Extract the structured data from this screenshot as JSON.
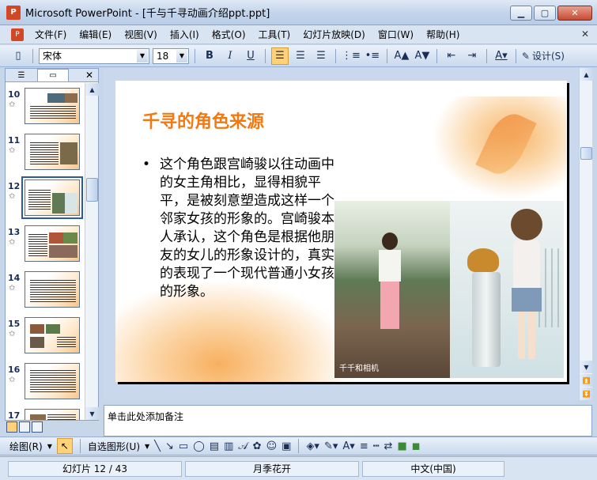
{
  "window": {
    "title": "Microsoft PowerPoint - [千与千寻动画介绍ppt.ppt]",
    "app_icon": "P"
  },
  "menu": {
    "items": [
      "文件(F)",
      "编辑(E)",
      "视图(V)",
      "插入(I)",
      "格式(O)",
      "工具(T)",
      "幻灯片放映(D)",
      "窗口(W)",
      "帮助(H)"
    ]
  },
  "toolbar": {
    "font_name": "宋体",
    "font_size": "18",
    "bold": "B",
    "italic": "I",
    "underline": "U",
    "design_label": "设计(S)"
  },
  "thumbnails": [
    {
      "num": "10"
    },
    {
      "num": "11"
    },
    {
      "num": "12",
      "selected": true
    },
    {
      "num": "13"
    },
    {
      "num": "14"
    },
    {
      "num": "15"
    },
    {
      "num": "16"
    },
    {
      "num": "17"
    }
  ],
  "slide": {
    "title": "千寻的角色来源",
    "body": "这个角色跟宫崎骏以往动画中的女主角相比，显得相貌平平，是被刻意塑造成这样一个邻家女孩的形象的。宫崎骏本人承认，这个角色是根据他朋友的女儿的形象设计的，真实的表现了一个现代普通小女孩的形象。",
    "photo_caption": "千千和相机"
  },
  "notes": {
    "placeholder": "单击此处添加备注"
  },
  "drawbar": {
    "draw_label": "绘图(R)",
    "autoshapes_label": "自选图形(U)"
  },
  "status": {
    "slide_count": "幻灯片 12 / 43",
    "design_name": "月季花开",
    "language": "中文(中国)"
  },
  "colors": {
    "title_orange": "#f07a12",
    "accent_highlight": "#ffd27a"
  }
}
